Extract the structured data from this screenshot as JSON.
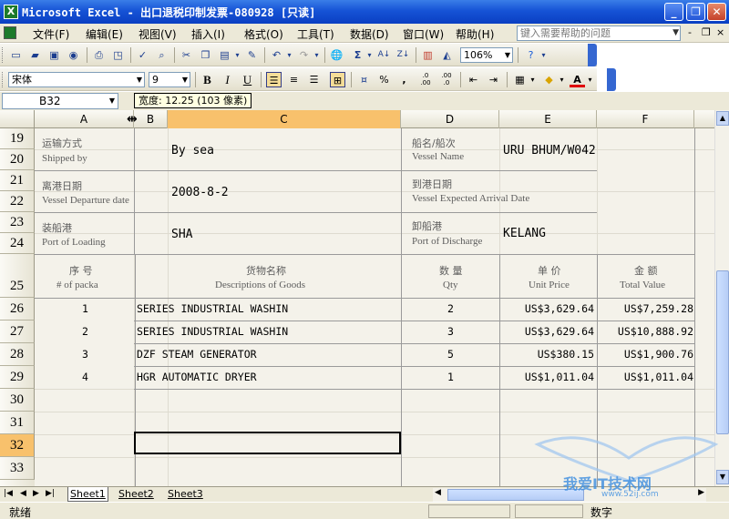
{
  "window": {
    "app_logo": "X",
    "title": "Microsoft Excel - 出口退税印制发票-080928  [只读]",
    "controls": {
      "minimize": "_",
      "restore": "❐",
      "close": "✕"
    }
  },
  "menu": {
    "items": [
      "文件(F)",
      "编辑(E)",
      "视图(V)",
      "插入(I)",
      "格式(O)",
      "工具(T)",
      "数据(D)",
      "窗口(W)",
      "帮助(H)"
    ],
    "help_placeholder": "键入需要帮助的问题",
    "doc_controls": {
      "minimize": "-",
      "restore": "❐",
      "close": "×"
    }
  },
  "toolbar": {
    "zoom": "106%",
    "sum_label": "Σ",
    "font_name": "宋体",
    "font_size": "9",
    "bold": "B",
    "italic": "I",
    "underline": "U",
    "percent": "%",
    "comma": ",",
    "inc_decimal": ".0 .00",
    "dec_decimal": ".00 .0",
    "font_color_label": "A"
  },
  "formula": {
    "name_box": "B32",
    "tooltip": "宽度: 12.25 (103 像素)"
  },
  "columns": [
    "A",
    "B",
    "C",
    "D",
    "E",
    "F"
  ],
  "active_column": "C",
  "rows": [
    "19",
    "20",
    "21",
    "22",
    "23",
    "24",
    "25",
    "26",
    "27",
    "28",
    "29",
    "30",
    "31",
    "32",
    "33"
  ],
  "active_row": "32",
  "sheet": {
    "shipped_by_cn": "运输方式",
    "shipped_by_en": "Shipped by",
    "shipped_by_val": "By sea",
    "vessel_cn": "船名/船次",
    "vessel_en": "Vessel Name",
    "vessel_val": "URU BHUM/W042",
    "departure_cn": "离港日期",
    "departure_en": "Vessel Departure date",
    "departure_val": "2008-8-2",
    "arrival_cn": "到港日期",
    "arrival_en": "Vessel Expected Arrival Date",
    "loading_cn": "装船港",
    "loading_en": "Port of Loading",
    "loading_val": "SHA",
    "discharge_cn": "卸船港",
    "discharge_en": "Port of Discharge",
    "discharge_val": "KELANG",
    "headers": {
      "no_cn": "序 号",
      "no_en": "# of packa",
      "desc_cn": "货物名称",
      "desc_en": "Descriptions of Goods",
      "qty_cn": "数 量",
      "qty_en": "Qty",
      "price_cn": "单 价",
      "price_en": "Unit Price",
      "value_cn": "金 额",
      "value_en": "Total Value"
    },
    "items": [
      {
        "no": "1",
        "desc": "SERIES INDUSTRIAL WASHIN",
        "qty": "2",
        "price": "US$3,629.64",
        "total": "US$7,259.28"
      },
      {
        "no": "2",
        "desc": "SERIES INDUSTRIAL WASHIN",
        "qty": "3",
        "price": "US$3,629.64",
        "total": "US$10,888.92"
      },
      {
        "no": "3",
        "desc": "DZF STEAM GENERATOR",
        "qty": "5",
        "price": "US$380.15",
        "total": "US$1,900.76"
      },
      {
        "no": "4",
        "desc": "HGR AUTOMATIC DRYER",
        "qty": "1",
        "price": "US$1,011.04",
        "total": "US$1,011.04"
      }
    ]
  },
  "tabs": {
    "nav": [
      "|◀",
      "◀",
      "▶",
      "▶|"
    ],
    "sheets": [
      "Sheet1",
      "Sheet2",
      "Sheet3"
    ],
    "active": "Sheet1"
  },
  "status": {
    "ready": "就绪",
    "num": "数字"
  },
  "watermark": {
    "text": "我爱IT技术网",
    "url": "www.52ij.com"
  }
}
